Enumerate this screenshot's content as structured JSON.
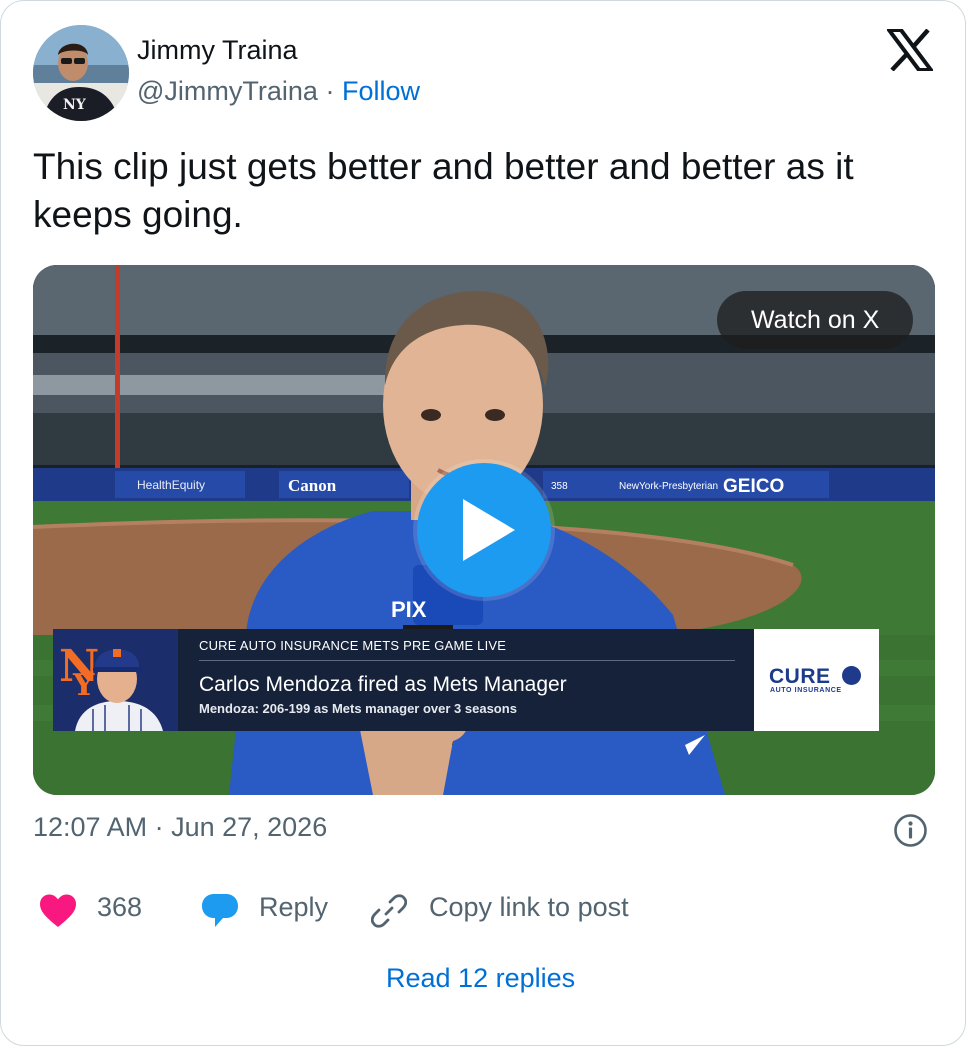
{
  "author": {
    "name": "Jimmy Traina",
    "handle": "@JimmyTraina",
    "separator": "·",
    "follow_label": "Follow"
  },
  "tweet": {
    "text": "This clip just gets better and better and better as it keeps going."
  },
  "media": {
    "watch_label": "Watch on X",
    "play_icon": "play-icon",
    "lower_third": {
      "kicker": "CURE AUTO INSURANCE METS PRE GAME LIVE",
      "headline": "Carlos Mendoza fired as Mets Manager",
      "subline": "Mendoza: 206-199 as Mets manager over 3 seasons",
      "sponsor_name": "CURE",
      "sponsor_sub": "AUTO INSURANCE"
    },
    "signage": {
      "wall_1": "HealthEquity",
      "wall_2": "Canon",
      "wall_3": "358",
      "wall_4": "NewYork-Presbyterian",
      "wall_5": "GEICO",
      "mic_flag": "PIX"
    }
  },
  "footer": {
    "timestamp": "12:07 AM · Jun 27, 2026",
    "info_icon": "info-icon"
  },
  "actions": {
    "like_count": "368",
    "reply_label": "Reply",
    "copy_label": "Copy link to post"
  },
  "read_replies_label": "Read 12 replies",
  "colors": {
    "link": "#006fd6",
    "muted": "#536471",
    "like": "#f91880",
    "reply": "#1d9bf0",
    "play": "#1d9bf0"
  }
}
